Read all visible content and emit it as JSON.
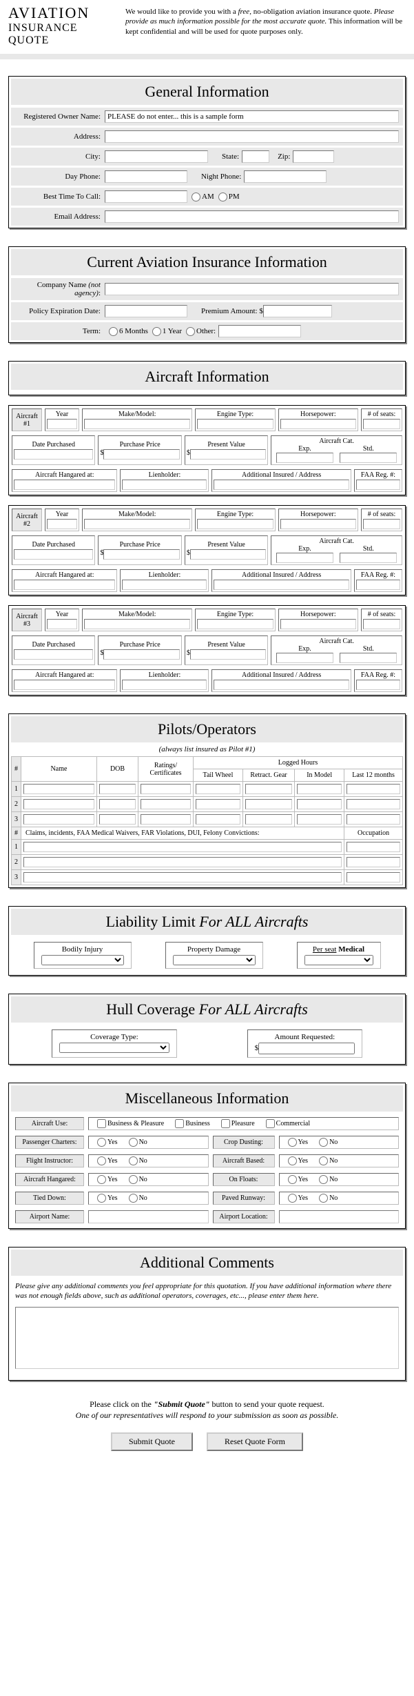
{
  "header": {
    "title1": "AVIATION",
    "title2": "INSURANCE",
    "title3": "QUOTE",
    "intro_pre": "We would like to provide you with a ",
    "intro_free": "free",
    "intro_mid": ", no-obligation aviation insurance quote. ",
    "intro_ital": "Please provide as much information possible for the most accurate quote.",
    "intro_post": " This information will be kept confidential and will be used for quote purposes only."
  },
  "sections": {
    "general": {
      "title": "General Information",
      "owner_lbl": "Registered Owner Name:",
      "owner_val": "PLEASE do not enter... this is a sample form",
      "address_lbl": "Address:",
      "city_lbl": "City:",
      "state_lbl": "State:",
      "zip_lbl": "Zip:",
      "dayphone_lbl": "Day Phone:",
      "nightphone_lbl": "Night Phone:",
      "besttime_lbl": "Best Time To Call:",
      "am": "AM",
      "pm": "PM",
      "email_lbl": "Email Address:"
    },
    "current": {
      "title": "Current Aviation Insurance Information",
      "company_lbl": "Company Name",
      "company_ital": "(not agency)",
      "policy_lbl": "Policy Expiration Date:",
      "premium_lbl": "Premium Amount: $",
      "term_lbl": "Term:",
      "term_6": "6 Months",
      "term_1": "1 Year",
      "term_other": "Other:"
    },
    "aircraft": {
      "title": "Aircraft Information",
      "labels": {
        "a1": "Aircraft #1",
        "a2": "Aircraft #2",
        "a3": "Aircraft #3",
        "year": "Year",
        "make": "Make/Model:",
        "engine": "Engine Type:",
        "hp": "Horsepower:",
        "seats": "# of seats:",
        "purchased": "Date Purchased",
        "price": "Purchase Price",
        "value": "Present Value",
        "cat": "Aircraft Cat.",
        "exp": "Exp.",
        "std": "Std.",
        "hangared": "Aircraft Hangared at:",
        "lien": "Lienholder:",
        "addins": "Additional Insured / Address",
        "faa": "FAA Reg. #:",
        "dollar": "$"
      }
    },
    "pilots": {
      "title": "Pilots/Operators",
      "subtitle": "(always list insured as Pilot #1)",
      "hdr": {
        "num": "#",
        "name": "Name",
        "dob": "DOB",
        "ratings": "Ratings/ Certificates",
        "logged": "Logged Hours",
        "tail": "Tail Wheel",
        "retract": "Retract. Gear",
        "inmodel": "In Model",
        "last12": "Last 12 months",
        "claims": "Claims, incidents, FAA Medical Waivers, FAR Violations, DUI, Felony Convictions:",
        "occ": "Occupation"
      },
      "rows": [
        "1",
        "2",
        "3"
      ]
    },
    "liability": {
      "title_a": "Liability Limit ",
      "title_b": "For ALL Aircrafts",
      "bi": "Bodily Injury",
      "pd": "Property Damage",
      "ps": "Per seat",
      "med": "Medical"
    },
    "hull": {
      "title_a": "Hull Coverage ",
      "title_b": "For ALL Aircrafts",
      "ct": "Coverage Type:",
      "amt": "Amount Requested:",
      "dollar": "$"
    },
    "misc": {
      "title": "Miscellaneous Information",
      "use": "Aircraft Use:",
      "use_bp": "Business & Pleasure",
      "use_b": "Business",
      "use_p": "Pleasure",
      "use_c": "Commercial",
      "charter": "Passenger Charters:",
      "crop": "Crop Dusting:",
      "instr": "Flight Instructor:",
      "based": "Aircraft Based:",
      "hang": "Aircraft Hangared:",
      "floats": "On Floats:",
      "tied": "Tied Down:",
      "paved": "Paved Runway:",
      "aname": "Airport Name:",
      "aloc": "Airport Location:",
      "yes": "Yes",
      "no": "No"
    },
    "comments": {
      "title": "Additional Comments",
      "note": "Please give any additional comments you feel appropriate for this quotation. If you have additional information where there was not enough fields above, such as additional operators, coverages, etc..., please enter them here."
    }
  },
  "footer": {
    "line1a": "Please click on the ",
    "line1b": "\"Submit Quote\"",
    "line1c": " button to send your quote request.",
    "line2": "One of our representatives will respond to your submission as soon as possible.",
    "submit": "Submit Quote",
    "reset": "Reset Quote Form"
  }
}
